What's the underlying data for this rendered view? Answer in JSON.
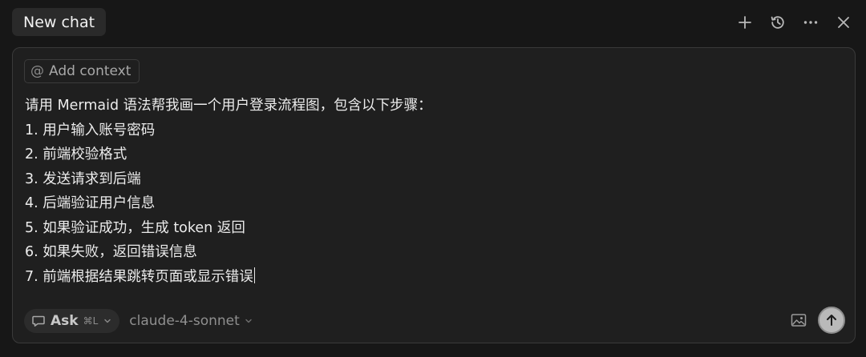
{
  "header": {
    "tab_title": "New chat",
    "actions": [
      {
        "name": "new-chat",
        "icon": "plus-icon"
      },
      {
        "name": "history",
        "icon": "history-icon"
      },
      {
        "name": "more",
        "icon": "more-icon"
      },
      {
        "name": "close",
        "icon": "close-icon"
      }
    ]
  },
  "composer": {
    "context_label": "Add context",
    "context_symbol": "@",
    "prompt_lines": [
      "请用 Mermaid 语法帮我画一个用户登录流程图，包含以下步骤：",
      "1. 用户输入账号密码",
      "2. 前端校验格式",
      "3. 发送请求到后端",
      "4. 后端验证用户信息",
      "5. 如果验证成功，生成 token 返回",
      "6. 如果失败，返回错误信息",
      "7. 前端根据结果跳转页面或显示错误"
    ],
    "mode_label": "Ask",
    "mode_shortcut": "⌘L",
    "model_label": "claude-4-sonnet"
  },
  "colors": {
    "background": "#171717",
    "panel": "#1f1f1f",
    "border": "#3a3a3a",
    "send_button": "#b9b9b9"
  }
}
